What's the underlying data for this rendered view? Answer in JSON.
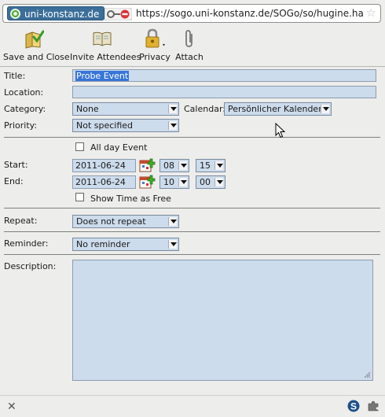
{
  "browser": {
    "site_host": "uni-konstanz.de",
    "url": "https://sogo.uni-konstanz.de/SOGo/so/hugine.hab"
  },
  "toolbar": {
    "items": [
      {
        "label": "Save and Close",
        "icon": "save-close-icon"
      },
      {
        "label": "Invite Attendees",
        "icon": "invite-book-icon"
      },
      {
        "label": "Privacy",
        "icon": "lock-icon"
      },
      {
        "label": "Attach",
        "icon": "paperclip-icon"
      }
    ]
  },
  "form": {
    "title_label": "Title:",
    "title_value": "Probe Event",
    "location_label": "Location:",
    "location_value": "",
    "category_label": "Category:",
    "category_value": "None",
    "calendar_label": "Calendar:",
    "calendar_value": "Persönlicher Kalender",
    "priority_label": "Priority:",
    "priority_value": "Not specified",
    "all_day_label": "All day Event",
    "all_day_checked": false,
    "start_label": "Start:",
    "start_date": "2011-06-24",
    "start_hour": "08",
    "start_minute": "15",
    "end_label": "End:",
    "end_date": "2011-06-24",
    "end_hour": "10",
    "end_minute": "00",
    "show_free_label": "Show Time as Free",
    "show_free_checked": false,
    "repeat_label": "Repeat:",
    "repeat_value": "Does not repeat",
    "reminder_label": "Reminder:",
    "reminder_value": "No reminder",
    "description_label": "Description:",
    "description_value": ""
  },
  "colors": {
    "field_bg": "#cddcec",
    "selection": "#3875d7",
    "site_badge": "#3b6f9a"
  }
}
